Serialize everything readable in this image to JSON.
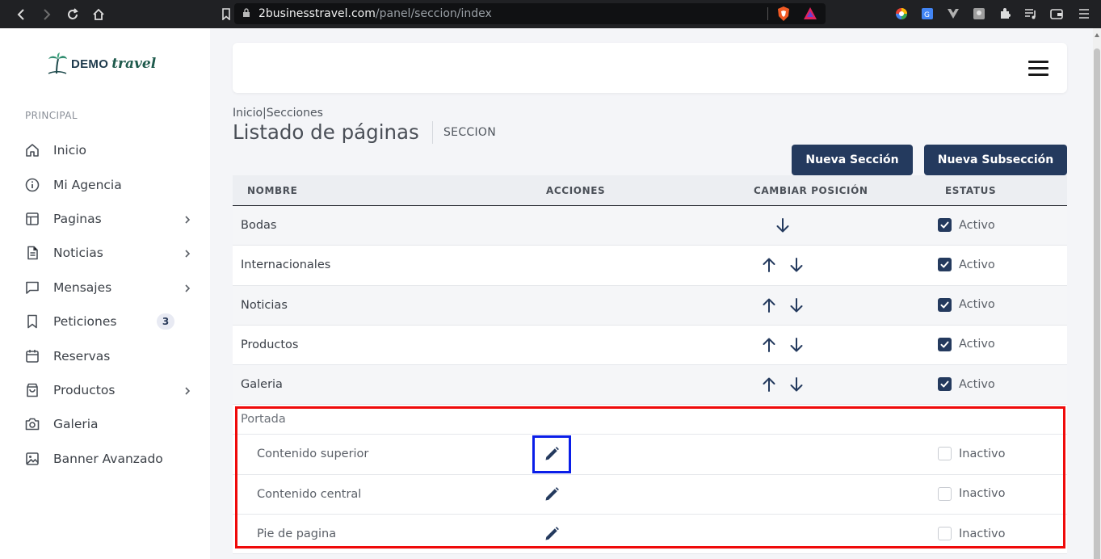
{
  "browser": {
    "url_host": "2businesstravel.com",
    "url_path": "/panel/seccion/index"
  },
  "sidebar": {
    "logo_demo": "DEMO",
    "logo_travel": "travel",
    "section_label": "PRINCIPAL",
    "items": [
      {
        "label": "Inicio",
        "icon": "home-icon",
        "chevron": false
      },
      {
        "label": "Mi Agencia",
        "icon": "info-icon",
        "chevron": false
      },
      {
        "label": "Paginas",
        "icon": "layout-icon",
        "chevron": true
      },
      {
        "label": "Noticias",
        "icon": "document-icon",
        "chevron": true
      },
      {
        "label": "Mensajes",
        "icon": "message-icon",
        "chevron": true
      },
      {
        "label": "Peticiones",
        "icon": "bookmark-icon",
        "chevron": false,
        "badge": "3"
      },
      {
        "label": "Reservas",
        "icon": "calendar-icon",
        "chevron": false
      },
      {
        "label": "Productos",
        "icon": "shopping-bag-icon",
        "chevron": true
      },
      {
        "label": "Galeria",
        "icon": "camera-icon",
        "chevron": false
      },
      {
        "label": "Banner Avanzado",
        "icon": "image-icon",
        "chevron": false
      }
    ]
  },
  "main": {
    "breadcrumb": "Inicio|Secciones",
    "title": "Listado de páginas",
    "subtitle": "SECCION",
    "buttons": {
      "new_section": "Nueva Sección",
      "new_subsection": "Nueva Subsección"
    }
  },
  "table": {
    "headers": [
      "NOMBRE",
      "ACCIONES",
      "CAMBIAR POSICIÓN",
      "ESTATUS"
    ],
    "rows": [
      {
        "name": "Bodas",
        "up": false,
        "down": true,
        "status": "Activo",
        "checked": true
      },
      {
        "name": "Internacionales",
        "up": true,
        "down": true,
        "status": "Activo",
        "checked": true
      },
      {
        "name": "Noticias",
        "up": true,
        "down": true,
        "status": "Activo",
        "checked": true
      },
      {
        "name": "Productos",
        "up": true,
        "down": true,
        "status": "Activo",
        "checked": true
      },
      {
        "name": "Galeria",
        "up": true,
        "down": true,
        "status": "Activo",
        "checked": true
      }
    ],
    "group": {
      "name": "Portada",
      "subrows": [
        {
          "name": "Contenido superior",
          "status": "Inactivo",
          "checked": false
        },
        {
          "name": "Contenido central",
          "status": "Inactivo",
          "checked": false
        },
        {
          "name": "Pie de pagina",
          "status": "Inactivo",
          "checked": false
        }
      ]
    }
  },
  "colors": {
    "accent": "#243a5e",
    "highlight_red": "#ef0a0a",
    "highlight_blue": "#0a1ee8"
  }
}
